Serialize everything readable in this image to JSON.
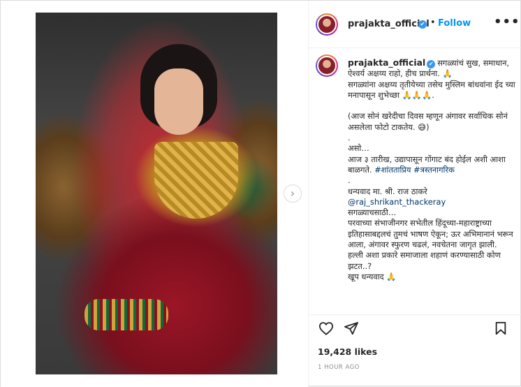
{
  "post": {
    "username": "prajakta_official",
    "verified_mark": "✔",
    "separator": "•",
    "follow_label": "Follow",
    "more_label": "•••",
    "next_arrow": "›"
  },
  "caption": {
    "line1": "सगळ्यांचं सुख, समाधान, ऐश्वर्य अक्षय्य राहो, हीच प्रार्थना. 🙏\nसगळ्यांना अक्षय्य तृतीयेच्या तसेच मुस्लिम बांधवांना ईद च्या मनापासून शुभेच्छा 🙏🙏🙏.\n\n(आज सोनं खरेदीचा दिवस म्हणून अंगावर सर्वाधिक सोनं असलेला फोटो टाकतेय. 😅)\n.\nअसो…\nआज ३ तारीख, उद्यापासून गोंगाट बंद होईल अशी आशा बाळगते. ",
    "hashtag1": "#शांतताप्रिय",
    "space": " ",
    "hashtag2": "#त्रस्तनागरिक",
    "line2": "\n.\nधन्यवाद मा. श्री. राज ठाकरे\n",
    "mention": "@raj_shrikant_thackeray",
    "line3": "\nसगळ्याचसाठी…\nपरवाच्या संभाजीनगर सभेतील हिंदूच्या-महाराष्ट्राच्या इतिहासाबद्दलचं तुमचं भाषण ऐकून; ऊर अभिमानानं भरून आला, अंगावर स्फुरण चढलं, नवचेतना जागृत झाली.\nहल्ली अशा प्रकारे समाजाला शहाणं करण्यासाठी कोण झटत..?\nखूप धन्यवाद 🙏"
  },
  "footer": {
    "likes": "19,428 likes",
    "timestamp": "1 HOUR AGO"
  },
  "icons": {
    "like": "heart-icon",
    "share": "paper-plane-icon",
    "save": "bookmark-icon"
  },
  "colors": {
    "accent": "#0095f6",
    "verified": "#3897f0",
    "link": "#00376b",
    "muted": "#8e8e8e"
  }
}
